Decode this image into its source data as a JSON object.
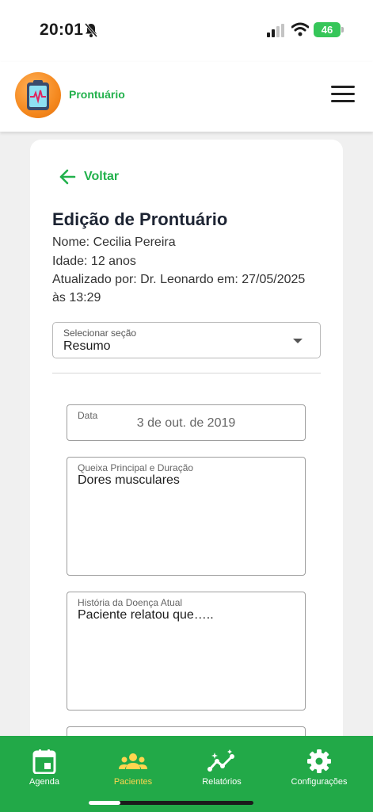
{
  "status_bar": {
    "time": "20:01",
    "battery": "46"
  },
  "header": {
    "app_name": "Prontuário",
    "logo_icon": "clipboard-heartbeat-icon",
    "menu_icon": "hamburger-menu-icon"
  },
  "card": {
    "back_label": "Voltar",
    "title": "Edição de Prontuário",
    "patient_name": "Nome: Cecilia Pereira",
    "patient_age": "Idade: 12 anos",
    "updated_by": "Atualizado por: Dr. Leonardo em: 27/05/2025 às 13:29",
    "section_select": {
      "label": "Selecionar seção",
      "value": "Resumo"
    },
    "fields": {
      "date": {
        "label": "Data",
        "value": "3 de out. de 2019"
      },
      "complaint": {
        "label": "Queixa Principal e Duração",
        "value": "Dores musculares"
      },
      "history": {
        "label": "História da Doença Atual",
        "value": "Paciente relatou que….."
      }
    }
  },
  "bottom_nav": {
    "items": [
      {
        "label": "Agenda",
        "icon": "calendar-icon"
      },
      {
        "label": "Pacientes",
        "icon": "people-icon",
        "active": true
      },
      {
        "label": "Relatórios",
        "icon": "chart-trend-icon"
      },
      {
        "label": "Configurações",
        "icon": "gear-icon"
      }
    ]
  },
  "colors": {
    "brand_green": "#22b14c",
    "nav_background": "#22a948",
    "active_nav": "#ffd54f",
    "logo_orange": "#f5891f"
  }
}
